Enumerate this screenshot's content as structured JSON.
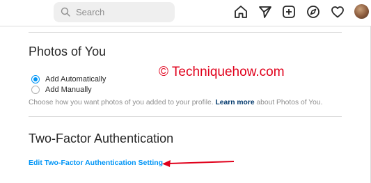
{
  "header": {
    "search_placeholder": "Search",
    "nav_icons": [
      "home-icon",
      "direct-message-icon",
      "new-post-icon",
      "explore-icon",
      "activity-heart-icon"
    ]
  },
  "photos_of_you": {
    "title": "Photos of You",
    "options": [
      {
        "label": "Add Automatically",
        "selected": true
      },
      {
        "label": "Add Manually",
        "selected": false
      }
    ],
    "help_before": "Choose how you want photos of you added to your profile. ",
    "help_link": "Learn more",
    "help_after": " about Photos of You."
  },
  "two_factor": {
    "title": "Two-Factor Authentication",
    "edit_link": "Edit Two-Factor Authentication Setting"
  },
  "watermark": "© Techniquehow.com",
  "colors": {
    "accent": "#0095f6",
    "link_dark": "#00376b",
    "annotation_red": "#e0001b",
    "divider": "#dbdbdb"
  }
}
